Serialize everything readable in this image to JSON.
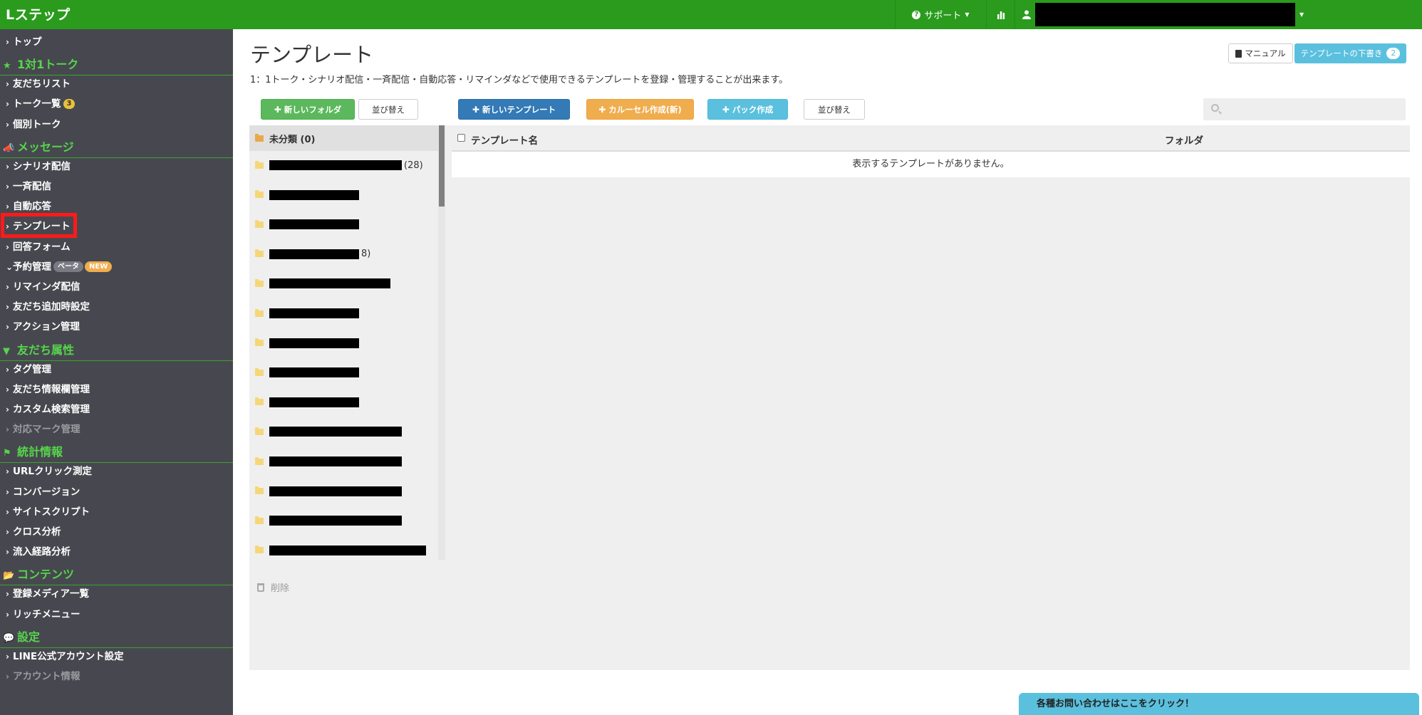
{
  "app": {
    "logo": "Lステップ",
    "support_label": "サポート"
  },
  "sidebar": {
    "items": [
      {
        "type": "item",
        "label": "トップ"
      },
      {
        "type": "section",
        "label": "1対1トーク"
      },
      {
        "type": "item",
        "label": "友だちリスト"
      },
      {
        "type": "item",
        "label": "トーク一覧",
        "badge": "3"
      },
      {
        "type": "item",
        "label": "個別トーク"
      },
      {
        "type": "section",
        "label": "メッセージ"
      },
      {
        "type": "item",
        "label": "シナリオ配信"
      },
      {
        "type": "item",
        "label": "一斉配信"
      },
      {
        "type": "item",
        "label": "自動応答"
      },
      {
        "type": "item",
        "label": "テンプレート",
        "active": true
      },
      {
        "type": "item",
        "label": "回答フォーム"
      },
      {
        "type": "item",
        "label": "予約管理",
        "beta": "ベータ",
        "new": "NEW"
      },
      {
        "type": "item",
        "label": "リマインダ配信"
      },
      {
        "type": "item",
        "label": "友だち追加時設定"
      },
      {
        "type": "item",
        "label": "アクション管理"
      },
      {
        "type": "section",
        "label": "友だち属性"
      },
      {
        "type": "item",
        "label": "タグ管理"
      },
      {
        "type": "item",
        "label": "友だち情報欄管理"
      },
      {
        "type": "item",
        "label": "カスタム検索管理"
      },
      {
        "type": "item",
        "label": "対応マーク管理",
        "disabled": true
      },
      {
        "type": "section",
        "label": "統計情報"
      },
      {
        "type": "item",
        "label": "URLクリック測定"
      },
      {
        "type": "item",
        "label": "コンバージョン"
      },
      {
        "type": "item",
        "label": "サイトスクリプト"
      },
      {
        "type": "item",
        "label": "クロス分析"
      },
      {
        "type": "item",
        "label": "流入経路分析"
      },
      {
        "type": "section",
        "label": "コンテンツ"
      },
      {
        "type": "item",
        "label": "登録メディア一覧"
      },
      {
        "type": "item",
        "label": "リッチメニュー"
      },
      {
        "type": "section",
        "label": "設定"
      },
      {
        "type": "item",
        "label": "LINE公式アカウント設定"
      },
      {
        "type": "item",
        "label": "アカウント情報",
        "disabled": true
      }
    ]
  },
  "page": {
    "title": "テンプレート",
    "description": "1：1トーク・シナリオ配信・一斉配信・自動応答・リマインダなどで使用できるテンプレートを登録・管理することが出来ます。",
    "manual_label": "マニュアル",
    "draft_label": "テンプレートの下書き",
    "draft_count": "2"
  },
  "toolbar": {
    "new_folder": "新しいフォルダ",
    "sort_folders": "並び替え",
    "new_template": "新しいテンプレート",
    "carousel": "カルーセル作成(新)",
    "pack": "パック作成",
    "sort_templates": "並び替え",
    "search_placeholder": ""
  },
  "folders": {
    "selected": "未分類 (0)",
    "rows": [
      {
        "suffix": "(28)"
      },
      {
        "suffix": ""
      },
      {
        "suffix": ""
      },
      {
        "suffix": "8)"
      },
      {
        "suffix": ""
      },
      {
        "suffix": ""
      },
      {
        "suffix": ""
      },
      {
        "suffix": ""
      },
      {
        "suffix": ""
      },
      {
        "suffix": ""
      },
      {
        "suffix": ""
      },
      {
        "suffix": ""
      },
      {
        "suffix": ""
      },
      {
        "suffix": ""
      }
    ],
    "delete_label": "削除"
  },
  "table": {
    "col_name": "テンプレート名",
    "col_folder": "フォルダ",
    "empty_message": "表示するテンプレートがありません。"
  },
  "contact": {
    "label": "各種お問い合わせはここをクリック！"
  },
  "colors": {
    "brand_green": "#2a9b1d",
    "sidebar_bg": "#47484f",
    "section_green": "#55d64a",
    "highlight_red": "#ff1a1a"
  }
}
